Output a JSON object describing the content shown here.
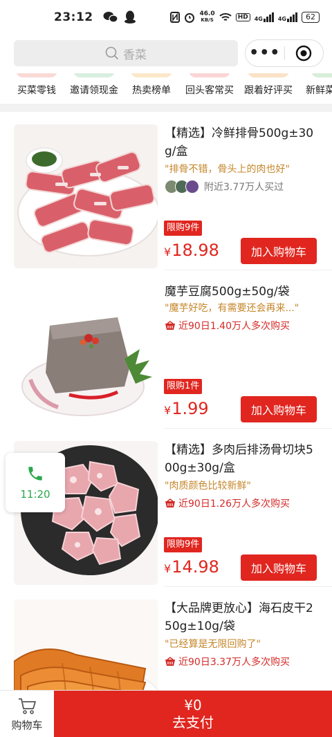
{
  "status_bar": {
    "time": "23:12",
    "net_speed_value": "46.0",
    "net_speed_unit": "KB/S",
    "hd_label": "HD",
    "signal_label_1": "4G",
    "signal_label_2": "4G",
    "battery": "62"
  },
  "search": {
    "placeholder": "香菜"
  },
  "categories": [
    {
      "label": "买菜零钱",
      "color": "#f9d9d6"
    },
    {
      "label": "邀请领现金",
      "color": "#d8efe0"
    },
    {
      "label": "热卖榜单",
      "color": "#fbe7c9"
    },
    {
      "label": "回头客常买",
      "color": "#fbd5d5"
    },
    {
      "label": "跟着好评买",
      "color": "#fbe2c7"
    },
    {
      "label": "新鲜菜",
      "color": "#d7eed9"
    }
  ],
  "products": [
    {
      "title": "【精选】冷鲜排骨500g±30g/盒",
      "quote": "\"排骨不错，骨头上的肉也好\"",
      "social": "附近3.77万人买过",
      "social_style": "avatars",
      "limit": "限购9件",
      "currency": "¥",
      "price": "18.98",
      "button": "加入购物车",
      "image": "ribs"
    },
    {
      "title": "魔芋豆腐500g±50g/袋",
      "quote": "\"魔芋好吃，有需要还会再来...\"",
      "social": "近90日1.40万人多次购买",
      "social_style": "basket",
      "limit": "限购1件",
      "currency": "¥",
      "price": "1.99",
      "button": "加入购物车",
      "image": "konjac"
    },
    {
      "title": "【精选】多肉后排汤骨切块500g±30g/盒",
      "quote": "\"肉质颜色比较新鲜\"",
      "social": "近90日1.26万人多次购买",
      "social_style": "basket",
      "limit": "限购9件",
      "currency": "¥",
      "price": "14.98",
      "button": "加入购物车",
      "image": "pork"
    },
    {
      "title": "【大品牌更放心】海石皮干250g±10g/袋",
      "quote": "\"已经算是无限回购了\"",
      "social": "近90日3.37万人多次购买",
      "social_style": "basket",
      "limit": "",
      "currency": "",
      "price": "",
      "button": "",
      "image": "tofu-skin"
    }
  ],
  "floating_call": {
    "time": "11:20",
    "icon": "phone-icon"
  },
  "bottom_bar": {
    "cart_label": "购物车",
    "total": "¥0",
    "pay_label": "去支付"
  },
  "colors": {
    "accent": "#e0261f",
    "quote": "#c5862a",
    "call_green": "#2aa84a"
  }
}
